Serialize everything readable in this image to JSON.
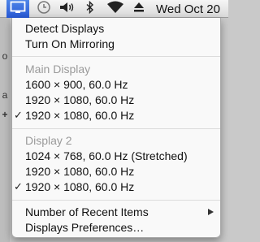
{
  "menubar": {
    "icons": [
      "display-icon",
      "clock-icon",
      "volume-icon",
      "bluetooth-icon",
      "wifi-icon",
      "eject-icon"
    ],
    "datetime": "Wed Oct 20",
    "highlight_color": "#3b6fe0"
  },
  "left_strip": {
    "glyphs": [
      "o",
      "a",
      "+"
    ]
  },
  "menu": {
    "detect_displays": "Detect Displays",
    "mirroring": "Turn On Mirroring",
    "main_display": {
      "header": "Main Display",
      "options": [
        {
          "label": "1600 × 900, 60.0 Hz",
          "checked": false
        },
        {
          "label": "1920 × 1080, 60.0 Hz",
          "checked": false
        },
        {
          "label": "1920 × 1080, 60.0 Hz",
          "checked": true
        }
      ]
    },
    "display_2": {
      "header": "Display 2",
      "options": [
        {
          "label": "1024 × 768, 60.0 Hz (Stretched)",
          "checked": false
        },
        {
          "label": "1920 × 1080, 60.0 Hz",
          "checked": false
        },
        {
          "label": "1920 × 1080, 60.0 Hz",
          "checked": true
        }
      ]
    },
    "recent_items": "Number of Recent Items",
    "preferences": "Displays Preferences…",
    "check_glyph": "✓"
  }
}
